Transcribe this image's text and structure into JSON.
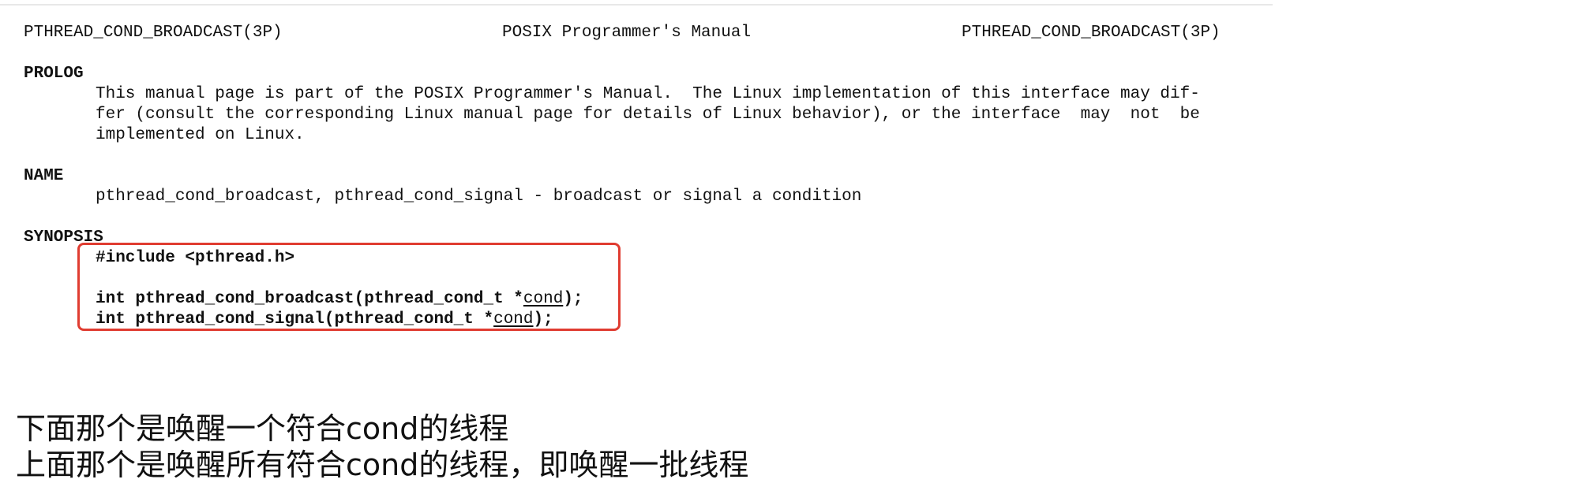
{
  "header": {
    "left": "PTHREAD_COND_BROADCAST(3P)",
    "center": "POSIX Programmer's Manual",
    "right": "PTHREAD_COND_BROADCAST(3P)"
  },
  "prolog": {
    "title": "PROLOG",
    "lines": [
      "This manual page is part of the POSIX Programmer's Manual.  The Linux implementation of this interface may dif-",
      "fer (consult the corresponding Linux manual page for details of Linux behavior), or the interface  may  not  be",
      "implemented on Linux."
    ]
  },
  "name_section": {
    "title": "NAME",
    "line": "pthread_cond_broadcast, pthread_cond_signal - broadcast or signal a condition"
  },
  "synopsis": {
    "title": "SYNOPSIS",
    "include": "#include <pthread.h>",
    "broadcast_prefix": "int pthread_cond_broadcast(pthread_cond_t *",
    "broadcast_arg": "cond",
    "broadcast_suffix": ");",
    "signal_prefix": "int pthread_cond_signal(pthread_cond_t *",
    "signal_arg": "cond",
    "signal_suffix": ");"
  },
  "notes": [
    "下面那个是唤醒一个符合cond的线程",
    "上面那个是唤醒所有符合cond的线程，即唤醒一批线程"
  ],
  "colors": {
    "highlight_border": "#e03c31",
    "text": "#111111"
  }
}
